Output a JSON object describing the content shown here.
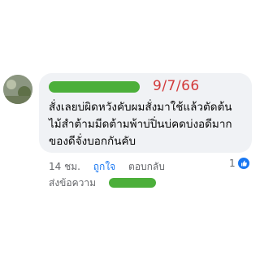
{
  "comment": {
    "date_note": "9/7/66",
    "lines": [
      "สั่งเลยบ่ผิดหวังคับผมสั่งมาใช้แล้วตัดต้น",
      "ไม้สำต้ามมีดต้ามพ้าบ่ปิ่นบ่คดบ่งอดีมาก",
      "ของดีจั่งบอกกันคับ"
    ],
    "time": "14 ชม.",
    "like_label": "ถูกใจ",
    "reply_label": "ตอบกลับ",
    "reaction_count": "1",
    "replies_label": "ส่งข้อความ"
  },
  "colors": {
    "like_blue": "#1877f2",
    "redaction_green": "#4caf3a",
    "date_red": "#d23a3a",
    "bubble_bg": "#f0f2f5"
  }
}
